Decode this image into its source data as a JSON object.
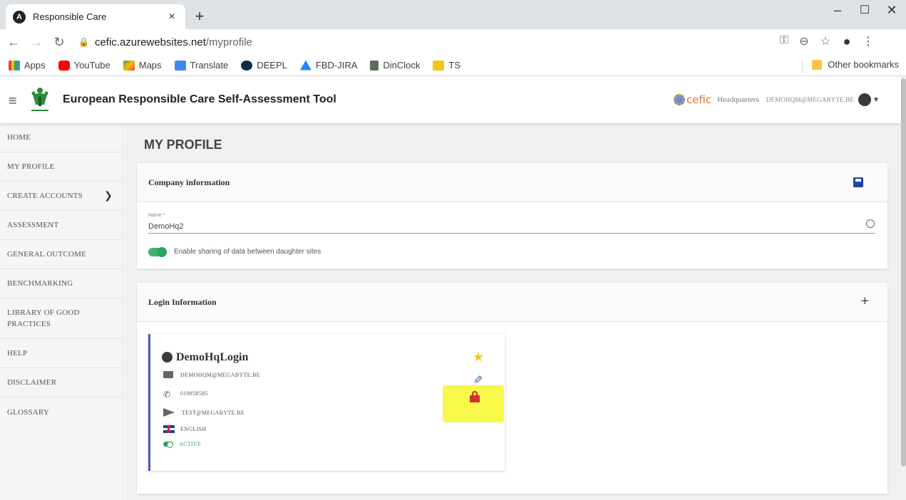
{
  "browser": {
    "tab_title": "Responsible Care",
    "tab_close": "×",
    "new_tab": "+",
    "url_host": "cefic.azurewebsites.net",
    "url_path": "/myprofile",
    "win_min": "–",
    "win_max": "☐",
    "win_close": "✕"
  },
  "bookmarks": {
    "items": [
      "Apps",
      "YouTube",
      "Maps",
      "Translate",
      "DEEPL",
      "FBD-JIRA",
      "DinClock",
      "TS"
    ],
    "other": "Other bookmarks"
  },
  "header": {
    "title": "European Responsible Care Self-Assessment Tool",
    "org_logo_text": "cefic",
    "org": "Headquarters",
    "user_email": "DEMOHQM@MEGABYTE.BE"
  },
  "sidebar": {
    "items": [
      {
        "label": "HOME"
      },
      {
        "label": "MY PROFILE"
      },
      {
        "label": "CREATE ACCOUNTS"
      },
      {
        "label": "ASSESSMENT"
      },
      {
        "label": "GENERAL OUTCOME"
      },
      {
        "label": "BENCHMARKING"
      },
      {
        "label": "LIBRARY OF GOOD PRACTICES"
      },
      {
        "label": "HELP"
      },
      {
        "label": "DISCLAIMER"
      },
      {
        "label": "GLOSSARY"
      }
    ]
  },
  "main": {
    "page_title": "MY PROFILE",
    "company": {
      "heading": "Company information",
      "name_label": "Name *",
      "name_value": "DemoHq2",
      "sharing_label": "Enable sharing of data between daughter sites",
      "sharing_enabled": true
    },
    "login": {
      "heading": "Login Information",
      "card": {
        "name": "DemoHqLogin",
        "email": "DEMOHQM@MEGABYTE.BE",
        "phone": "019858585",
        "send_to": "TEST@MEGABYTE.BE",
        "language": "ENGLISH",
        "status": "ACTIVE",
        "favorite": true
      }
    }
  },
  "colors": {
    "accent": "#4a58b8",
    "toggle": "#2aa45b",
    "save_icon": "#1e46a8",
    "star": "#f5c518",
    "lock": "#d32f2f",
    "highlight": "#f7f72a"
  }
}
